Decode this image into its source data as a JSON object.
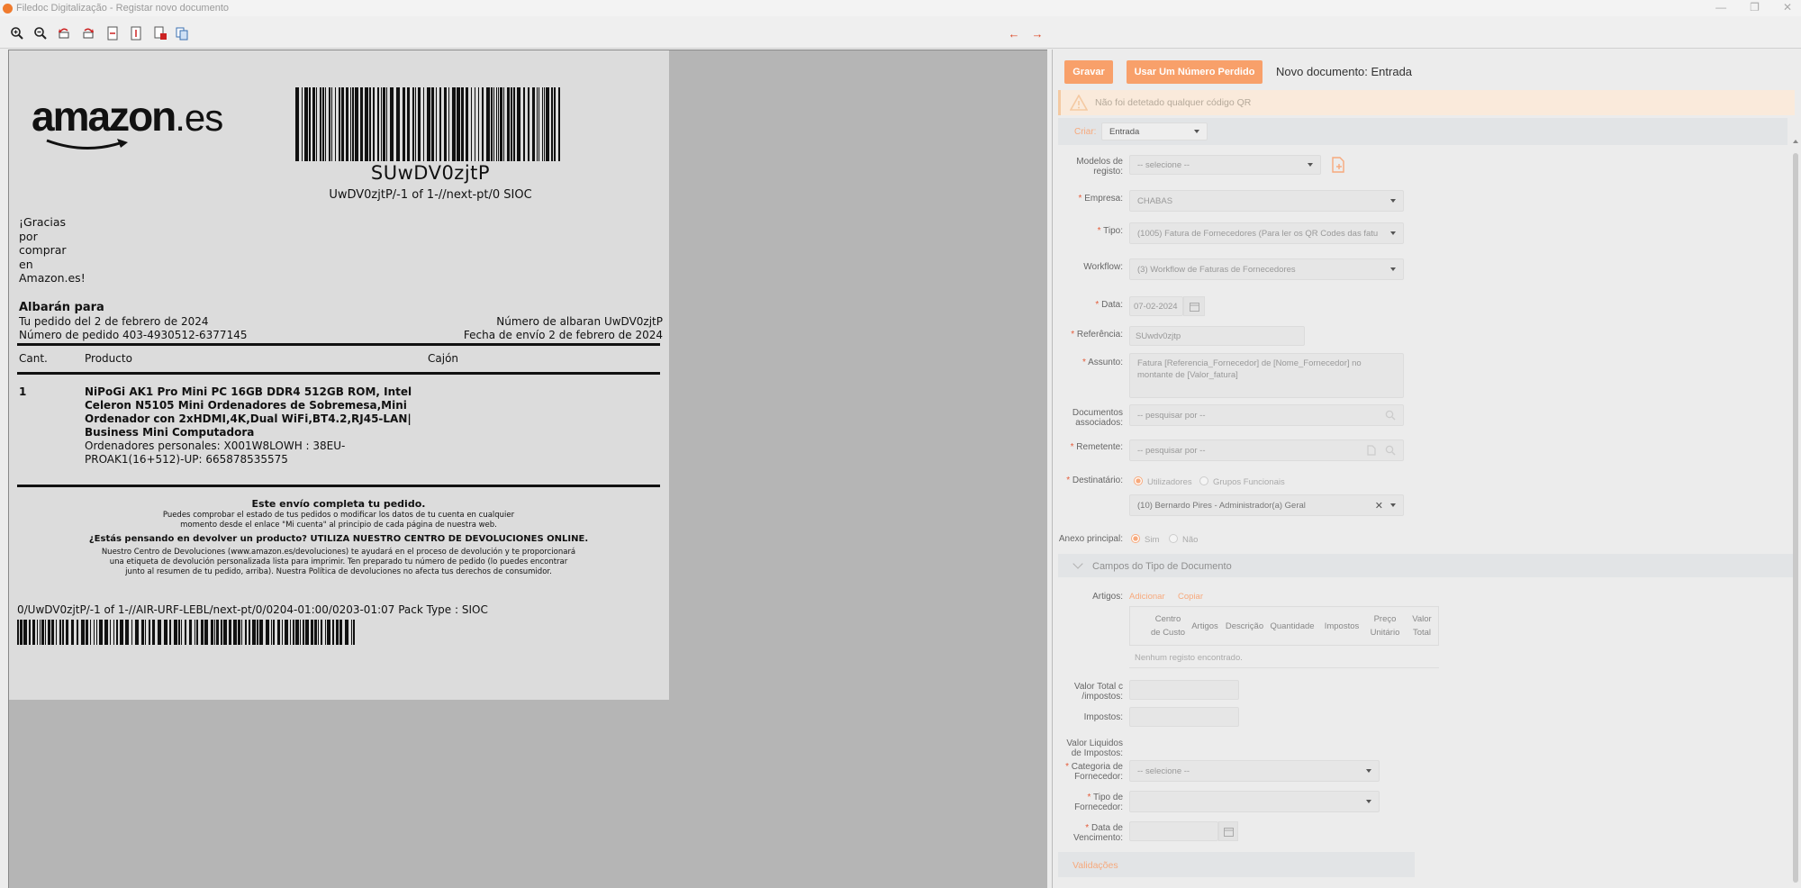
{
  "window": {
    "title": "Filedoc Digitalização - Registar novo documento",
    "controls": [
      "—",
      "❐",
      "✕"
    ]
  },
  "toolbar": {
    "icons": [
      "zoom-in-icon",
      "zoom-out-icon",
      "rotate-left-icon",
      "rotate-right-icon",
      "fit-page-icon",
      "fit-width-icon",
      "page-add-icon",
      "page-copy-icon"
    ],
    "prev_arrow": "←",
    "next_arrow": "→"
  },
  "doc": {
    "logo": {
      "main": "amazon",
      "suffix": ".es"
    },
    "barcode_code": "SUwDV0zjtP",
    "barcode_sub": "UwDV0zjtP/-1 of 1-//next-pt/0 SIOC",
    "thanks": [
      "¡Gracias",
      "por",
      "comprar",
      "en",
      "Amazon.es!"
    ],
    "albaran": "Albarán para",
    "order_date": "Tu pedido del 2 de febrero de 2024",
    "order_number": "Número de pedido 403-4930512-6377145",
    "delivery_note": "Número de albaran UwDV0zjtP",
    "ship_date": "Fecha de envío 2 de febrero de 2024",
    "col_qty": "Cant.",
    "col_product": "Producto",
    "col_drawer": "Cajón",
    "item_qty": "1",
    "item_lines": [
      "NiPoGi AK1 Pro Mini PC 16GB DDR4 512GB ROM, Intel",
      "Celeron N5105 Mini Ordenadores de Sobremesa,Mini",
      "Ordenador con 2xHDMI,4K,Dual WiFi,BT4.2,RJ45-LAN|",
      "Business Mini Computadora"
    ],
    "item_detail_lines": [
      "Ordenadores personales: X001W8LOWH : 38EU-",
      "PROAK1(16+512)-UP: 665878535575"
    ],
    "complete": "Este envío completa tu pedido.",
    "status_lines": [
      "Puedes comprobar el estado de tus pedidos o modificar los datos de tu cuenta en cualquier",
      "momento desde el enlace \"Mi cuenta\" al principio de cada página de nuestra web."
    ],
    "returns_title": "¿Estás pensando en devolver un producto? UTILIZA NUESTRO CENTRO DE DEVOLUCIONES ONLINE.",
    "returns_lines": [
      "Nuestro Centro de Devoluciones (www.amazon.es/devoluciones) te ayudará en el proceso de devolución y te proporcionará",
      "una etiqueta de devolución personalizada lista para imprimir. Ten preparado tu número de pedido (lo puedes encontrar",
      "junto al resumen de tu pedido, arriba). Nuestra Política de devoluciones no afecta tus derechos de consumidor."
    ],
    "pack_line": "0/UwDV0zjtP/-1 of 1-//AIR-URF-LEBL/next-pt/0/0204-01:00/0203-01:07 Pack Type : SIOC"
  },
  "form": {
    "save_label": "Gravar",
    "lost_number_label": "Usar Um Número Perdido",
    "title": "Novo documento: Entrada",
    "qr_alert": "Não foi detetado qualquer código QR",
    "criar_label": "Criar:",
    "criar_value": "Entrada",
    "modelos_label_1": "Modelos de",
    "modelos_label_2": "registo:",
    "modelos_value": "-- selecione --",
    "empresa_label": "Empresa:",
    "empresa_value": "CHABAS",
    "tipo_label": "Tipo:",
    "tipo_value": "(1005) Fatura de Fornecedores (Para ler os QR Codes das fatu",
    "workflow_label": "Workflow:",
    "workflow_value": "(3) Workflow de Faturas de Fornecedores",
    "data_label": "Data:",
    "data_value": "07-02-2024",
    "referencia_label": "Referência:",
    "referencia_value": "SUwdv0zjtp",
    "assunto_label": "Assunto:",
    "assunto_value": "Fatura [Referencia_Fornecedor] de [Nome_Fornecedor] no montante de [Valor_fatura]",
    "docs_label_1": "Documentos",
    "docs_label_2": "associados:",
    "docs_placeholder": "-- pesquisar por --",
    "remetente_label": "Remetente:",
    "remetente_placeholder": "-- pesquisar por --",
    "destinatario_label": "Destinatário:",
    "dest_opt_users": "Utilizadores",
    "dest_opt_groups": "Grupos Funcionais",
    "dest_value": "(10) Bernardo Pires - Administrador(a) Geral",
    "anexo_label": "Anexo principal:",
    "anexo_yes": "Sim",
    "anexo_no": "Não",
    "section_title": "Campos do Tipo de Documento",
    "artigos_label": "Artigos:",
    "add_label": "Adicionar",
    "copy_label": "Copiar",
    "table_headers": [
      "Centro de Custo",
      "Artigos",
      "Descrição",
      "Quantidade",
      "Impostos",
      "Preço Unitário",
      "Valor Total"
    ],
    "empty_row": "Nenhum registo encontrado.",
    "valor_total_label_1": "Valor Total c",
    "valor_total_label_2": "/impostos:",
    "impostos_label": "Impostos:",
    "valor_liq_label_1": "Valor Liquidos",
    "valor_liq_label_2": "de Impostos:",
    "cat_label_1": "Categoria de",
    "cat_label_2": "Fornecedor:",
    "cat_value": "-- selecione --",
    "tipo_forn_label_1": "Tipo de",
    "tipo_forn_label_2": "Fornecedor:",
    "venc_label_1": "Data de",
    "venc_label_2": "Vencimento:",
    "validacoes": "Validações"
  },
  "colors": {
    "accent": "#f8a06a",
    "required": "#e55c3a",
    "alert_bg": "#faeadb"
  }
}
